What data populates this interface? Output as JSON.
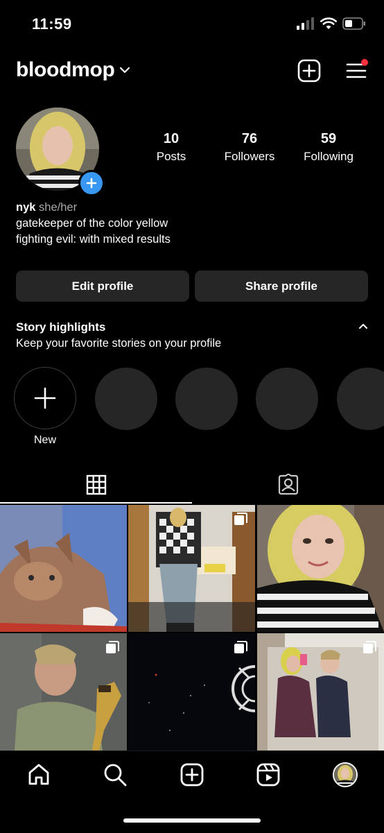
{
  "status_bar": {
    "time": "11:59"
  },
  "header": {
    "username": "bloodmop"
  },
  "profile": {
    "stats": [
      {
        "value": "10",
        "label": "Posts"
      },
      {
        "value": "76",
        "label": "Followers"
      },
      {
        "value": "59",
        "label": "Following"
      }
    ],
    "bio": {
      "name": "nyk",
      "pronouns": "she/her",
      "lines": [
        "gatekeeper of the color yellow",
        "fighting evil: with mixed results"
      ]
    }
  },
  "buttons": {
    "edit": "Edit profile",
    "share": "Share profile"
  },
  "highlights": {
    "title": "Story highlights",
    "subtitle": "Keep your favorite stories on your profile",
    "new_label": "New"
  },
  "tabs": [
    "grid-icon",
    "tagged-icon"
  ],
  "bottom_nav": [
    "home-icon",
    "search-icon",
    "create-icon",
    "reels-icon",
    "profile-avatar"
  ],
  "colors": {
    "accent": "#3897f0",
    "notification": "#ff3040",
    "surface": "#262626"
  }
}
